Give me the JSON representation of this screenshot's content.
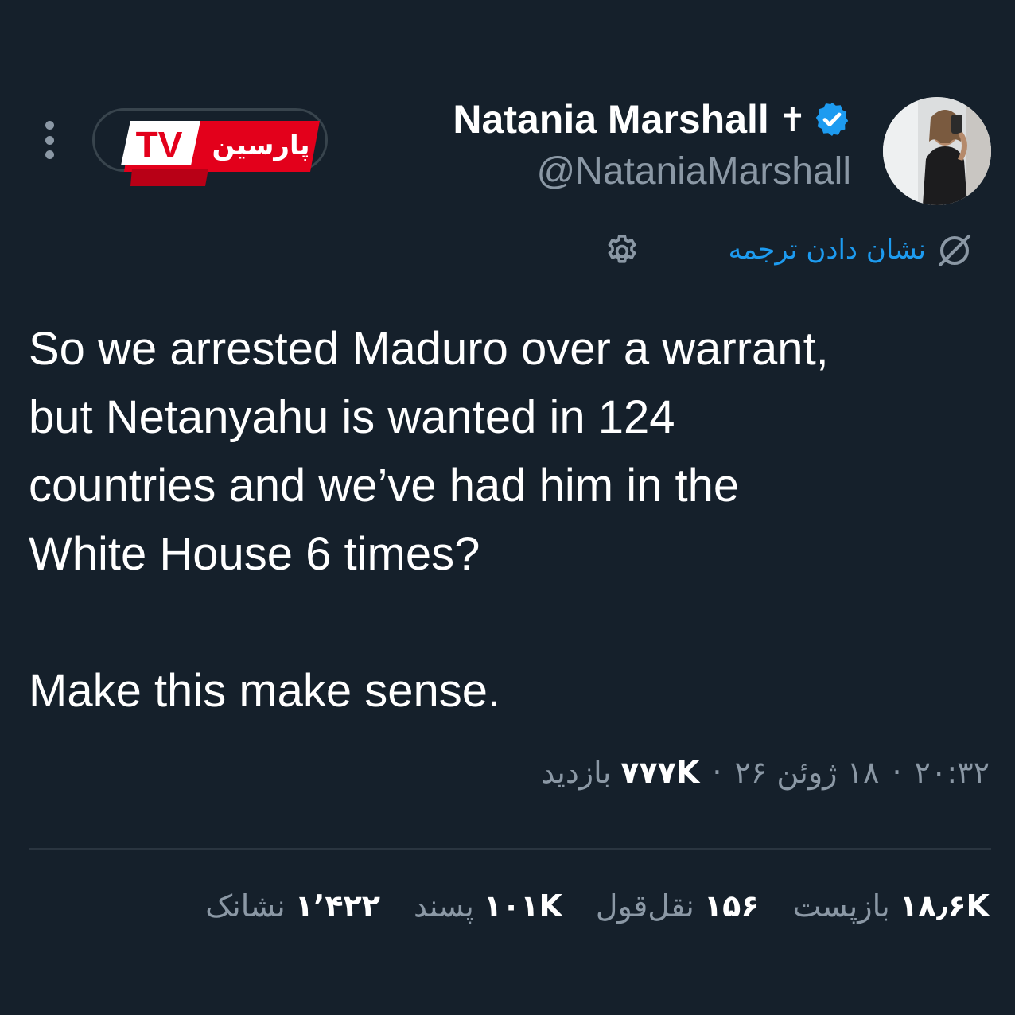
{
  "colors": {
    "background": "#15202b",
    "accent": "#1d9bf0",
    "muted": "#8b98a5",
    "logo_red": "#e3001b"
  },
  "header": {
    "menu_icon": "more-vertical-icon",
    "logo_text": "پارسین",
    "logo_badge": "TV"
  },
  "author": {
    "name": "Natania Marshall",
    "emoji": "✝",
    "verified_icon": "verified-badge-icon",
    "handle": "@NataniaMarshall"
  },
  "translate": {
    "label": "نشان دادن ترجمه",
    "icon": "translate-icon",
    "settings_icon": "gear-icon"
  },
  "tweet": {
    "lines": [
      "So we arrested Maduro over a warrant,",
      "but Netanyahu is wanted in 124",
      "countries and we’ve had him in the",
      "White House 6 times?"
    ],
    "closing": "Make this make sense."
  },
  "meta": {
    "time": "۲۰:۳۲",
    "date": "۱۸ ژوئن ۲۶",
    "views_count": "۷۷۷K",
    "views_label": "بازدید"
  },
  "stats": {
    "reposts": {
      "count": "۱۸٫۶K",
      "label": "بازپست"
    },
    "quotes": {
      "count": "۱۵۶",
      "label": "نقل‌قول"
    },
    "likes": {
      "count": "۱۰۱K",
      "label": "پسند"
    },
    "bookmarks": {
      "count": "۱٬۴۲۲",
      "label": "نشانک"
    }
  }
}
